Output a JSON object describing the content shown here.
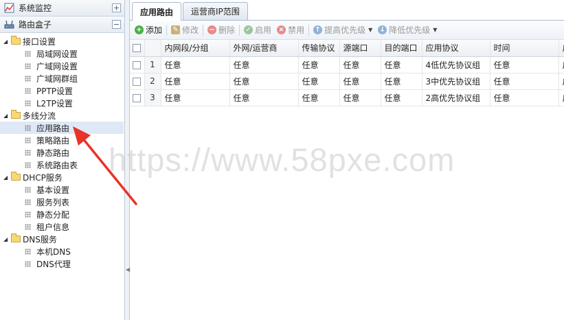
{
  "left_panel": {
    "section1": {
      "title": "系统监控",
      "icon": "monitor-chart-icon",
      "tool": "+"
    },
    "section2": {
      "title": "路由盒子",
      "icon": "router-icon",
      "tool": "−"
    },
    "tree": [
      {
        "label": "接口设置",
        "type": "group"
      },
      {
        "label": "局域网设置",
        "type": "leaf"
      },
      {
        "label": "广域网设置",
        "type": "leaf"
      },
      {
        "label": "广域网群组",
        "type": "leaf"
      },
      {
        "label": "PPTP设置",
        "type": "leaf"
      },
      {
        "label": "L2TP设置",
        "type": "leaf"
      },
      {
        "label": "多线分流",
        "type": "group"
      },
      {
        "label": "应用路由",
        "type": "leaf",
        "selected": true
      },
      {
        "label": "策略路由",
        "type": "leaf"
      },
      {
        "label": "静态路由",
        "type": "leaf"
      },
      {
        "label": "系统路由表",
        "type": "leaf"
      },
      {
        "label": "DHCP服务",
        "type": "group"
      },
      {
        "label": "基本设置",
        "type": "leaf"
      },
      {
        "label": "服务列表",
        "type": "leaf"
      },
      {
        "label": "静态分配",
        "type": "leaf"
      },
      {
        "label": "租户信息",
        "type": "leaf"
      },
      {
        "label": "DNS服务",
        "type": "group"
      },
      {
        "label": "本机DNS",
        "type": "leaf"
      },
      {
        "label": "DNS代理",
        "type": "leaf"
      }
    ]
  },
  "tabs": [
    {
      "label": "应用路由",
      "active": true
    },
    {
      "label": "运营商IP范围",
      "active": false
    }
  ],
  "toolbar": {
    "add": "添加",
    "edit": "修改",
    "delete": "删除",
    "enable": "启用",
    "disable": "禁用",
    "raise_priority": "提高优先级",
    "lower_priority": "降低优先级"
  },
  "table": {
    "columns": [
      "内网段/分组",
      "外网/运营商",
      "传输协议",
      "源端口",
      "目的端口",
      "应用协议",
      "时间",
      "启"
    ],
    "rows": [
      {
        "no": "1",
        "cells": [
          "任意",
          "任意",
          "任意",
          "任意",
          "任意",
          "4低优先协议组",
          "任意",
          "启"
        ]
      },
      {
        "no": "2",
        "cells": [
          "任意",
          "任意",
          "任意",
          "任意",
          "任意",
          "3中优先协议组",
          "任意",
          "启"
        ]
      },
      {
        "no": "3",
        "cells": [
          "任意",
          "任意",
          "任意",
          "任意",
          "任意",
          "2高优先协议组",
          "任意",
          "启"
        ]
      }
    ]
  },
  "watermark": "https://www.58pxe.com",
  "colors": {
    "accent_arrow": "#e8332a",
    "selected_row": "#dfe8f6",
    "header_border": "#a6b8cc"
  }
}
